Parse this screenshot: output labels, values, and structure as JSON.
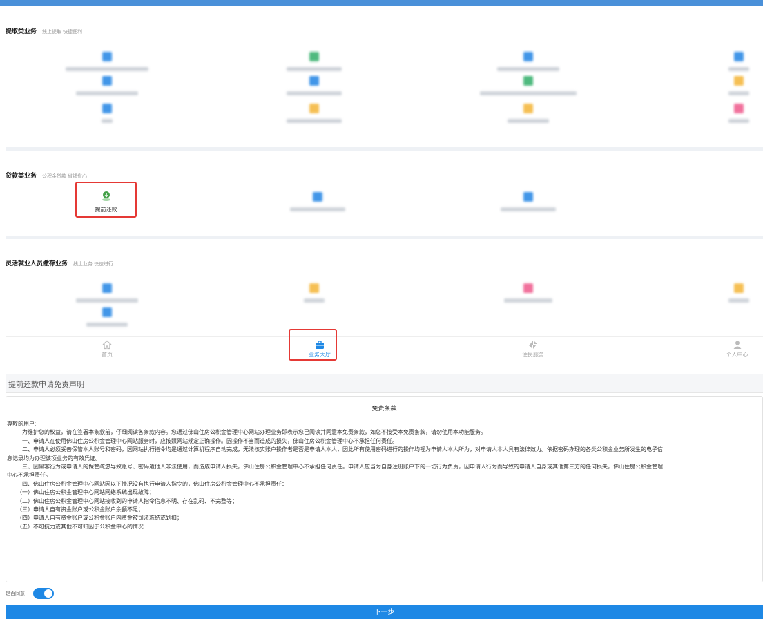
{
  "sections": {
    "withdrawal": {
      "title": "提取类业务",
      "subtitle": "线上提取 快捷便利"
    },
    "loan": {
      "title": "贷款类业务",
      "subtitle": "公积金贷款 省钱省心"
    },
    "flexible": {
      "title": "灵活就业人员缴存业务",
      "subtitle": "线上业务 快速进行"
    }
  },
  "loan_tiles": {
    "early_repayment": "提前还款"
  },
  "tabbar": [
    {
      "label": "首页",
      "icon": "home-icon"
    },
    {
      "label": "业务大厅",
      "icon": "briefcase-icon"
    },
    {
      "label": "便民服务",
      "icon": "service-icon"
    },
    {
      "label": "个人中心",
      "icon": "user-icon"
    }
  ],
  "disclaimer": {
    "header": "提前还款申请免责声明",
    "title": "免责条款",
    "greeting": "尊敬的用户:",
    "lines": [
      "为维护您的权益，请在签署本条款前，仔细阅读各条款内容。您通过佛山住房公积金管理中心网站办理业务即表示您已阅读并同意本免责条款，如您不接受本免责条款，请勿使用本功能服务。",
      "一、申请人在使用佛山住房公积金管理中心网站服务时，应按照网站规定正确操作。因操作不当而造成的损失，佛山住房公积金管理中心不承担任何责任。",
      "二、申请人必须妥善保管本人账号和密码，因网站执行指令均是通过计算机程序自动完成，无法核实账户操作者是否是申请人本人，因此所有使用密码进行的操作均视为申请人本人所为，对申请人本人具有法律效力。依据密码办理的各类公积金业务所发生的电子信",
      "息记录均为办理该项业务的有效凭证。",
      "三、因黑客行为或申请人的保管疏忽导致账号、密码遭他人非法使用，而造成申请人损失，佛山住房公积金管理中心不承担任何责任。申请人应当为自身注册账户下的一切行为负责，因申请人行为而导致的申请人自身或其他第三方的任何损失，佛山住房公积金管理",
      "中心不承担责任。",
      "四、佛山住房公积金管理中心网站因以下情况没有执行申请人指令的，佛山住房公积金管理中心不承担责任：",
      "（一）佛山住房公积金管理中心网站网络系统出现故障；",
      "（二）佛山住房公积金管理中心网站接收到的申请人指令信息不明、存在乱码、不完整等；",
      "（三）申请人自有资金账户或公积金账户余额不足；",
      "（四）申请人自有资金账户或公积金账户内资金被司法冻结或划扣；",
      "（五）不可抗力或其他不可归因于公积金中心的情况"
    ]
  },
  "agree": {
    "label": "是否同意",
    "checked": true
  },
  "next_button": "下一步",
  "colors": {
    "accent": "#1e88e5",
    "highlight": "#e53935",
    "repay_icon": "#43a047"
  }
}
